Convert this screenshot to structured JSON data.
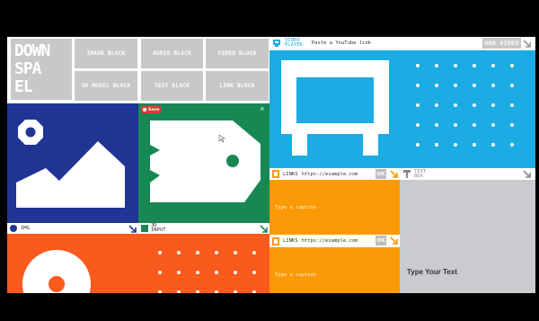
{
  "logo": {
    "lines": [
      "DOWN",
      "SPA",
      "EL"
    ]
  },
  "toolbar": {
    "image_block": "IMAGE BLOCK",
    "audio_block": "AUDIO BLOCK",
    "video_block": "VIDEO BLOCK",
    "model_block": "3D MODEL BLOCK",
    "text_block": "TEXT BLOCK",
    "link_block": "LINK BLOCK"
  },
  "video_player": {
    "label_line1": "VIDEO",
    "label_line2": "PLAYER",
    "input_placeholder": "Paste a YouTube link",
    "add_button": "ADD VIDEO"
  },
  "save_badge": {
    "label": "Save"
  },
  "img_panel": {
    "label": "IMG"
  },
  "input_panel": {
    "label_line1": "3D",
    "label_line2": "INPUT"
  },
  "links_top": {
    "label": "LINKS",
    "url": "https://example.com",
    "ok": "OK",
    "caption_placeholder": "Type a caption"
  },
  "links_bottom": {
    "label": "LINKS",
    "url": "https://example.com",
    "ok": "OK",
    "caption_placeholder": "Type a caption"
  },
  "text_box": {
    "label_line1": "TEXT",
    "label_line2": "BOX",
    "content": "Type Your Text"
  },
  "colors": {
    "navy": "#1f3493",
    "green": "#178853",
    "sky": "#1aace3",
    "orange": "#fb9a06",
    "orange_red": "#fa5a1c",
    "gray": "#c8c8c8"
  }
}
